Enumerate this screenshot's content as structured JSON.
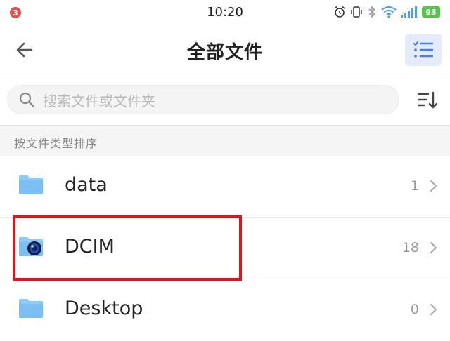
{
  "status_bar": {
    "notification_count": "3",
    "time": "10:20",
    "battery": "93"
  },
  "header": {
    "title": "全部文件"
  },
  "search": {
    "placeholder": "搜索文件或文件夹"
  },
  "section": {
    "label": "按文件类型排序"
  },
  "files": [
    {
      "name": "data",
      "count": "1"
    },
    {
      "name": "DCIM",
      "count": "18"
    },
    {
      "name": "Desktop",
      "count": "0"
    }
  ],
  "colors": {
    "accent": "#4a7cf0",
    "folder": "#7fc3f5",
    "highlight": "#e2141b"
  }
}
